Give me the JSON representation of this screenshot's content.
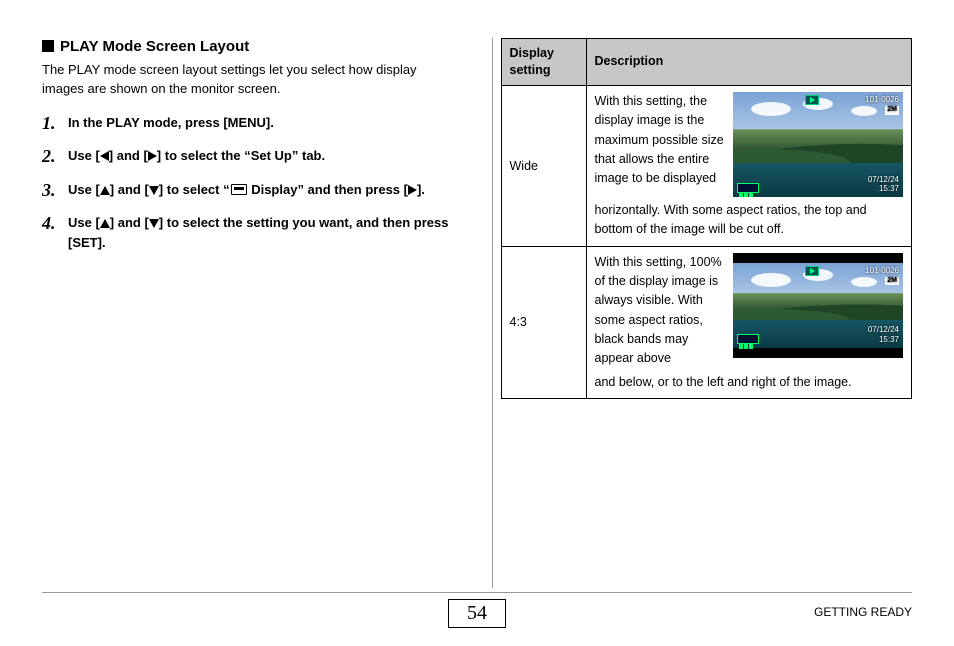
{
  "section_title": "PLAY Mode Screen Layout",
  "intro": "The PLAY mode screen layout settings let you select how display images are shown on the monitor screen.",
  "steps": {
    "s1": "In the PLAY mode, press [MENU].",
    "s2_a": "Use [",
    "s2_b": "] and [",
    "s2_c": "] to select the “Set Up” tab.",
    "s3_a": "Use [",
    "s3_b": "] and [",
    "s3_c": "] to select “",
    "s3_d": " Display” and then press [",
    "s3_e": "].",
    "s4_a": "Use [",
    "s4_b": "] and [",
    "s4_c": "] to select the setting you want, and then press [SET]."
  },
  "table": {
    "header_setting": "Display setting",
    "header_desc": "Description",
    "rows": [
      {
        "name": "Wide",
        "text_beside": "With this setting, the display image is the maximum possible size that allows the entire image to be displayed",
        "text_after": "horizontally. With some aspect ratios, the top and bottom of the image will be cut off."
      },
      {
        "name": "4:3",
        "text_beside": "With this setting, 100% of the display image is always visible. With some aspect ratios, black bands may appear above",
        "text_after": "and below, or to the left and right of the image."
      }
    ]
  },
  "osd": {
    "folder_file": "101-0026",
    "size_badge": "2M",
    "date": "07/12/24",
    "time": "15:37"
  },
  "footer": {
    "page": "54",
    "label": "GETTING READY"
  }
}
